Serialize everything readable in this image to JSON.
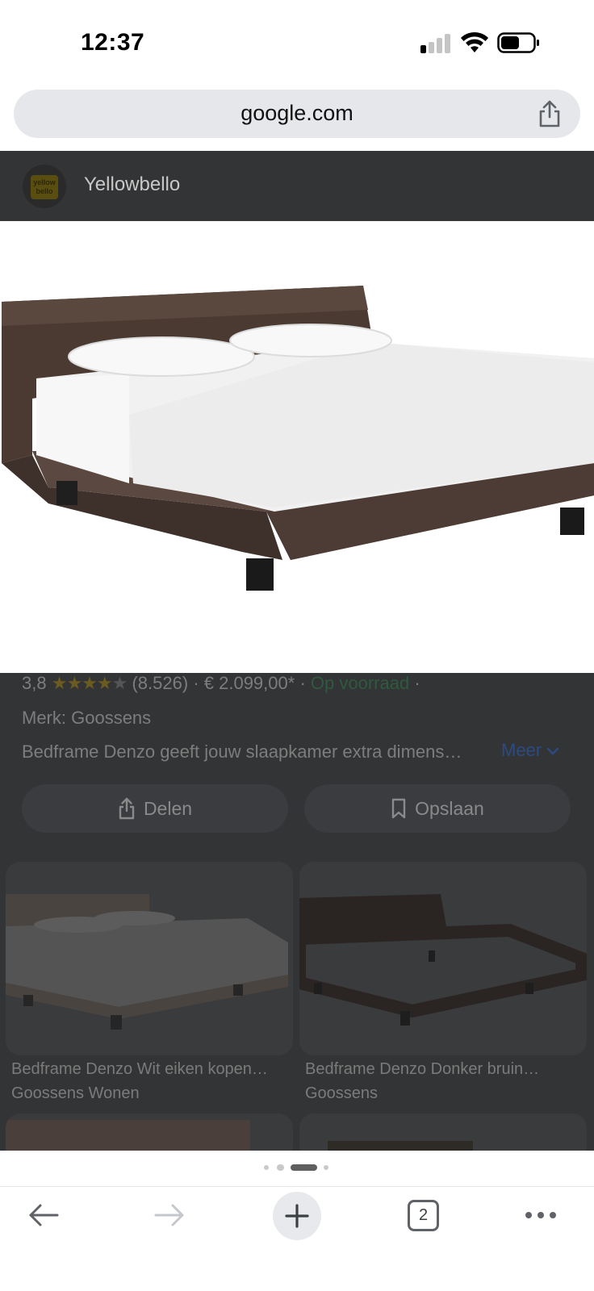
{
  "status_bar": {
    "time": "12:37"
  },
  "browser": {
    "url": "google.com"
  },
  "source": {
    "logo_text_1": "yellow",
    "logo_text_2": "bello",
    "name": "Yellowbello"
  },
  "product": {
    "rating": "3,8",
    "stars_filled": 3.8,
    "stars_total": 5,
    "reviews": "(8.526)",
    "separator": "·",
    "price": "€ 2.099,00*",
    "stock": "Op voorraad",
    "brand": "Merk: Goossens",
    "description": "Bedframe Denzo geeft jouw slaapkamer extra dimens…",
    "more_label": "Meer"
  },
  "actions": {
    "share_label": "Delen",
    "save_label": "Opslaan"
  },
  "related": [
    {
      "title": "Bedframe Denzo Wit eiken kopen…",
      "source": "Goossens Wonen"
    },
    {
      "title": "Bedframe Denzo Donker bruin…",
      "source": "Goossens"
    }
  ],
  "pager": {
    "dot_count": 4,
    "active_index": 2
  },
  "toolbar": {
    "tab_count": "2"
  },
  "colors": {
    "url_bar_bg": "#e5e7ea",
    "overlay_bg": "#333435",
    "link_blue": "#2d4b82",
    "stock_green": "#2f5a3f"
  }
}
